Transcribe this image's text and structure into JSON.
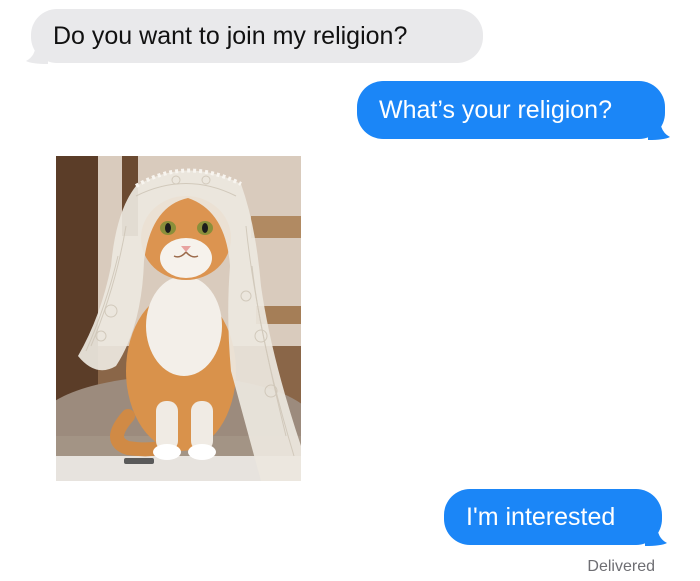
{
  "messages": [
    {
      "direction": "received",
      "text": "Do you want to join my religion?"
    },
    {
      "direction": "sent",
      "text": "What’s your religion?"
    },
    {
      "direction": "received",
      "type": "photo",
      "icon": "cat-photo"
    },
    {
      "direction": "sent",
      "text": "I'm interested"
    }
  ],
  "delivery_status": "Delivered",
  "colors": {
    "sent_bubble": "#1b86f7",
    "received_bubble": "#e9e9eb",
    "status_text": "#6e6e73"
  }
}
